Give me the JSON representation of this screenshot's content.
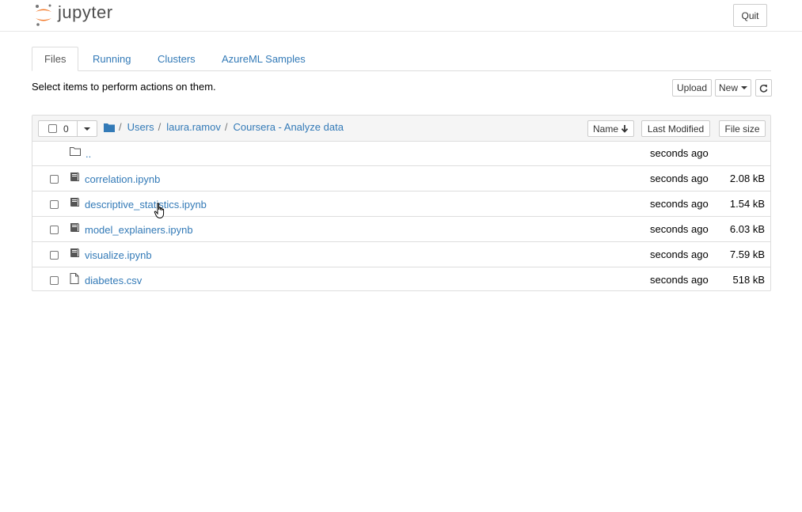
{
  "header": {
    "logo_text": "jupyter",
    "quit_label": "Quit"
  },
  "tabs": [
    {
      "label": "Files",
      "active": true
    },
    {
      "label": "Running",
      "active": false
    },
    {
      "label": "Clusters",
      "active": false
    },
    {
      "label": "AzureML Samples",
      "active": false
    }
  ],
  "toolbar": {
    "tip": "Select items to perform actions on them.",
    "upload_label": "Upload",
    "new_label": "New",
    "refresh_icon": "refresh-icon"
  },
  "list": {
    "selected_count": "0",
    "breadcrumb": [
      "Users",
      "laura.ramov",
      "Coursera - Analyze data"
    ],
    "sort_name_label": "Name",
    "sort_modified_label": "Last Modified",
    "sort_size_label": "File size",
    "parent_dir": {
      "name": "..",
      "modified": "seconds ago"
    },
    "items": [
      {
        "name": "correlation.ipynb",
        "type": "notebook",
        "modified": "seconds ago",
        "size": "2.08 kB"
      },
      {
        "name": "descriptive_statistics.ipynb",
        "type": "notebook",
        "modified": "seconds ago",
        "size": "1.54 kB"
      },
      {
        "name": "model_explainers.ipynb",
        "type": "notebook",
        "modified": "seconds ago",
        "size": "6.03 kB"
      },
      {
        "name": "visualize.ipynb",
        "type": "notebook",
        "modified": "seconds ago",
        "size": "7.59 kB"
      },
      {
        "name": "diabetes.csv",
        "type": "file",
        "modified": "seconds ago",
        "size": "518 kB"
      }
    ]
  },
  "colors": {
    "link": "#337ab7",
    "jupyter_orange": "#f37726",
    "border": "#dddddd"
  }
}
